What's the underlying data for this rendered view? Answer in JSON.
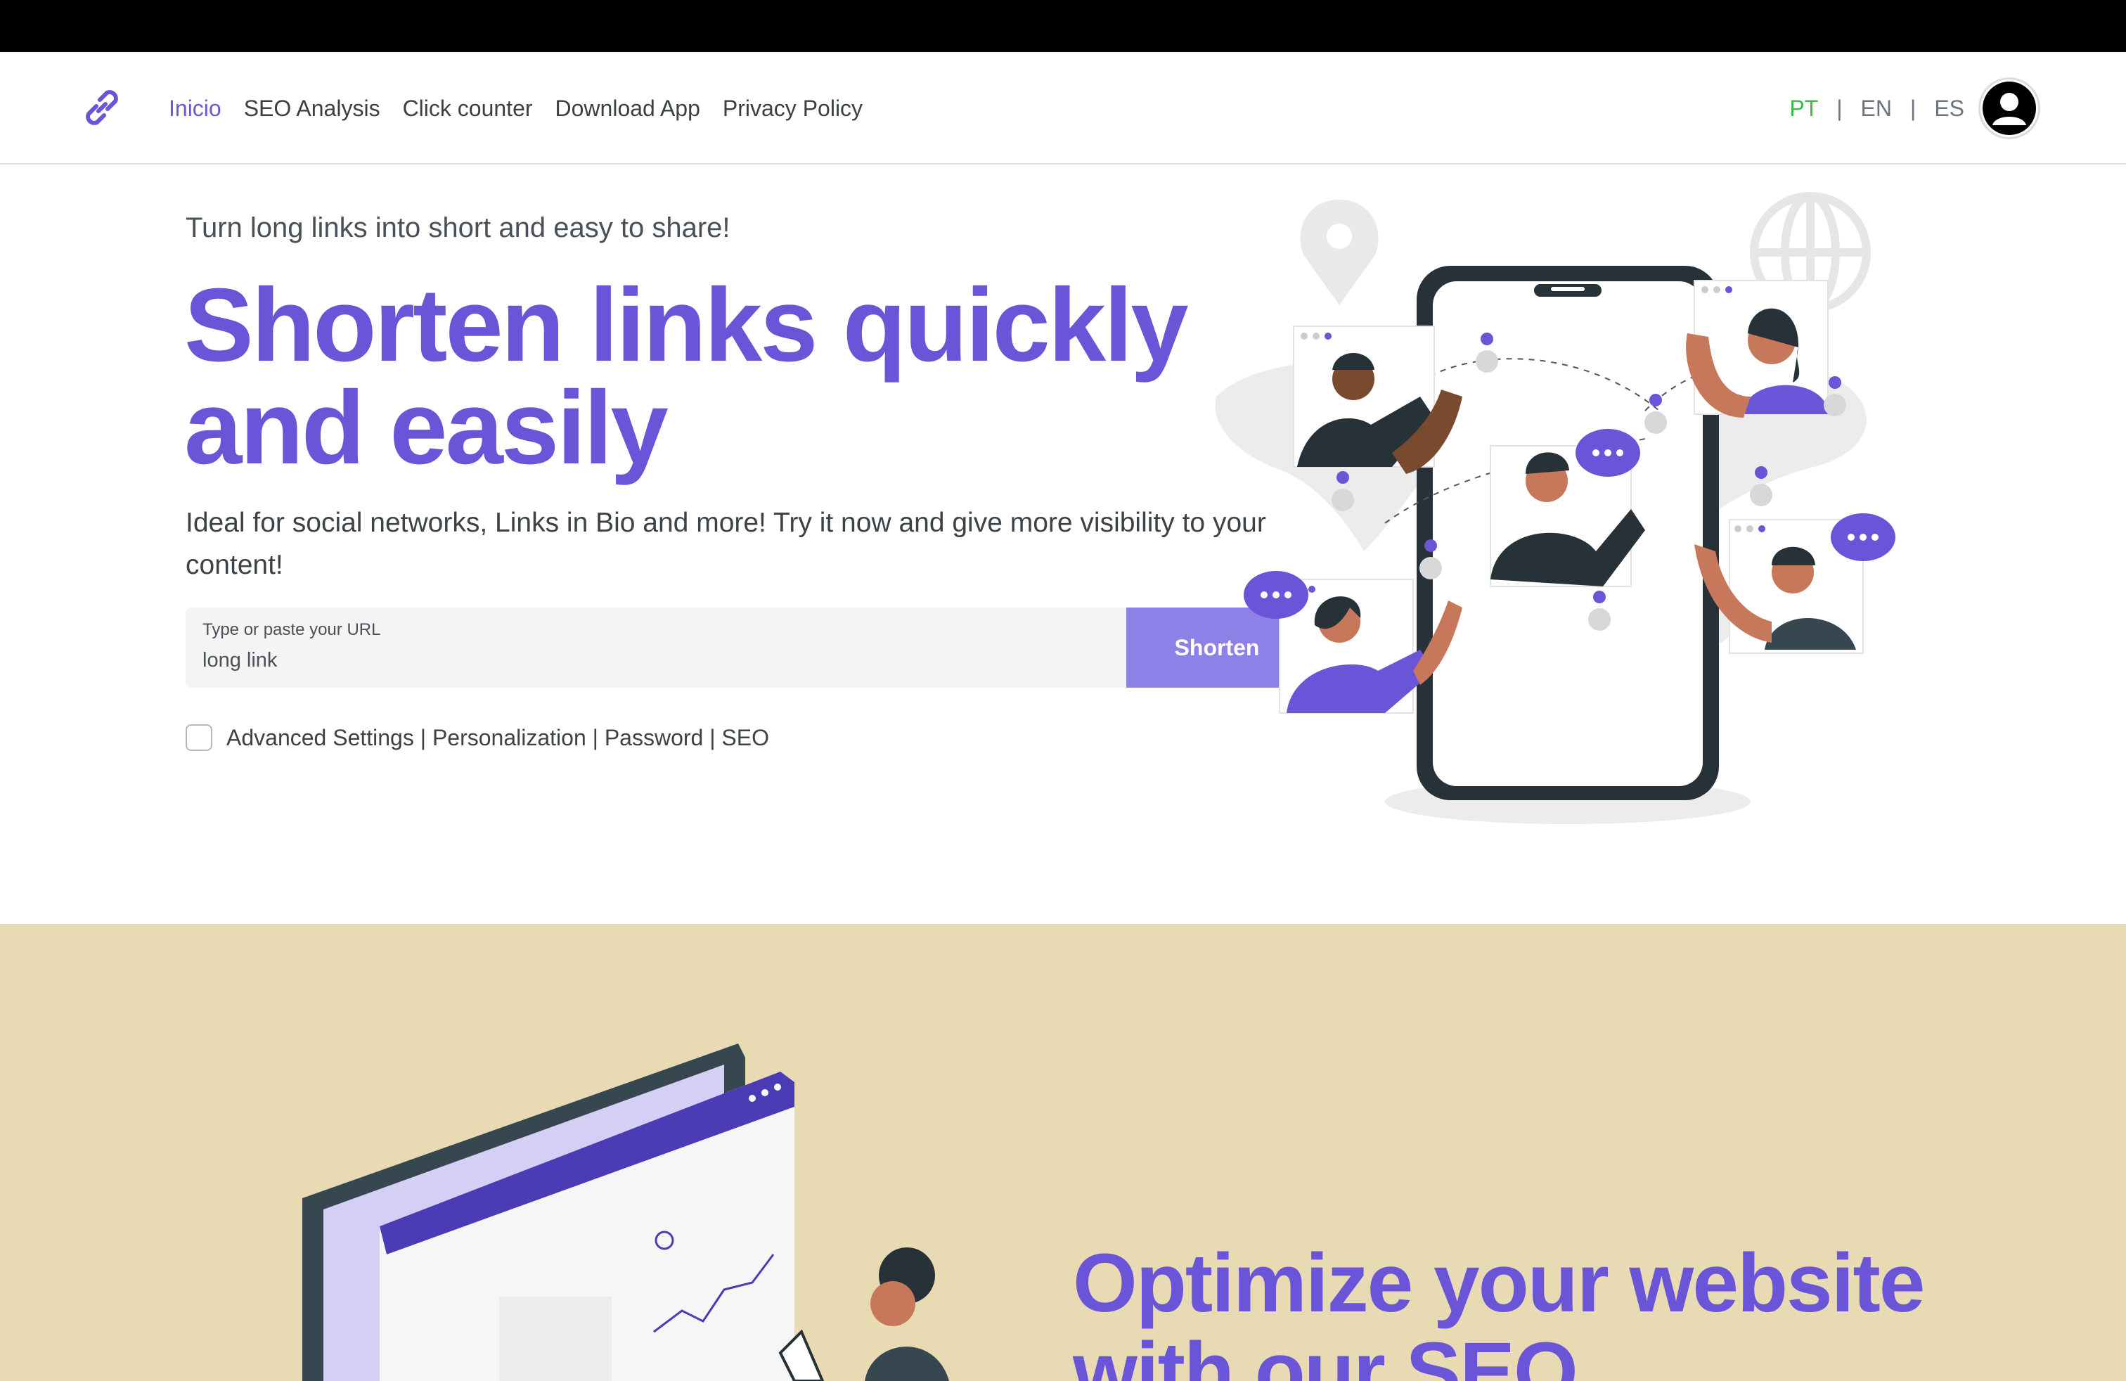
{
  "navbar": {
    "links": [
      {
        "label": "Inicio"
      },
      {
        "label": "SEO Analysis"
      },
      {
        "label": "Click counter"
      },
      {
        "label": "Download App"
      },
      {
        "label": "Privacy Policy"
      }
    ],
    "languages": [
      "PT",
      "EN",
      "ES"
    ],
    "separator": "|"
  },
  "hero": {
    "subtitle": "Turn long links into short and easy to share!",
    "title": "Shorten links quickly and easily",
    "description": "Ideal for social networks, Links in Bio and more! Try it now and give more visibility to your content!",
    "input_label": "Type or paste your URL",
    "input_placeholder": "long link",
    "button_label": "Shorten",
    "advanced_label": "Advanced Settings | Personalization | Password | SEO"
  },
  "seo_section": {
    "title": "Optimize your website with our SEO"
  },
  "colors": {
    "accent": "#6a55d8",
    "button": "#8d80e6",
    "active_language": "#3fb950",
    "section_background": "#e8dab3"
  }
}
